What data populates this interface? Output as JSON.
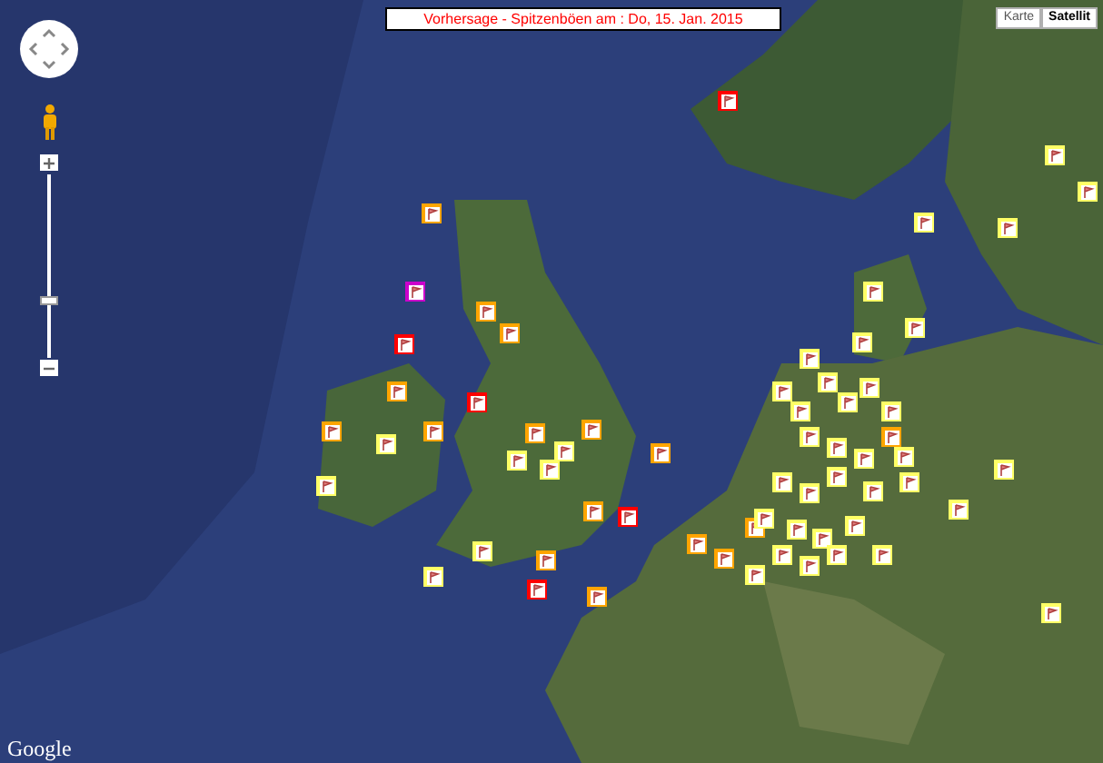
{
  "title_banner": "Vorhersage - Spitzenböen am : Do, 15. Jan. 2015",
  "map_type_buttons": [
    {
      "label": "Karte",
      "selected": false
    },
    {
      "label": "Satellit",
      "selected": true
    }
  ],
  "zoom_slider": {
    "level": 0.32
  },
  "logo": "Google",
  "markers": [
    {
      "color": "#ff0000"
    },
    {
      "color": "#cc00cc"
    },
    {
      "color": "#ffa500"
    },
    {
      "color": "#ffa500"
    },
    {
      "color": "#ffa500"
    },
    {
      "color": "#ff0000"
    },
    {
      "color": "#ffa500"
    },
    {
      "color": "#ffff66"
    },
    {
      "color": "#ffa500"
    },
    {
      "color": "#ff0000"
    },
    {
      "color": "#ffff66"
    },
    {
      "color": "#ffa500"
    },
    {
      "color": "#ffa500"
    },
    {
      "color": "#ffff66"
    },
    {
      "color": "#ffff66"
    },
    {
      "color": "#ff0000"
    },
    {
      "color": "#ffa500"
    },
    {
      "color": "#ffa500"
    },
    {
      "color": "#ffff66"
    },
    {
      "color": "#ffff66"
    },
    {
      "color": "#ff0000"
    },
    {
      "color": "#ffa500"
    },
    {
      "color": "#ffff66"
    },
    {
      "color": "#ffa500"
    },
    {
      "color": "#ffa500"
    },
    {
      "color": "#ffa500"
    },
    {
      "color": "#ffa500"
    },
    {
      "color": "#ffa500"
    },
    {
      "color": "#ffff66"
    },
    {
      "color": "#ffff66"
    },
    {
      "color": "#ffff66"
    },
    {
      "color": "#ffff66"
    },
    {
      "color": "#ffff66"
    },
    {
      "color": "#ffff66"
    },
    {
      "color": "#ffff66"
    },
    {
      "color": "#ffff66"
    },
    {
      "color": "#ffff66"
    },
    {
      "color": "#ffff66"
    },
    {
      "color": "#ffff66"
    },
    {
      "color": "#ffa500"
    },
    {
      "color": "#ffff66"
    },
    {
      "color": "#ffff66"
    },
    {
      "color": "#ffff66"
    },
    {
      "color": "#ffff66"
    },
    {
      "color": "#ffff66"
    },
    {
      "color": "#ffff66"
    },
    {
      "color": "#ffff66"
    },
    {
      "color": "#ffff66"
    },
    {
      "color": "#ffff66"
    },
    {
      "color": "#ffff66"
    },
    {
      "color": "#ffff66"
    },
    {
      "color": "#ffff66"
    },
    {
      "color": "#ffff66"
    },
    {
      "color": "#ffff66"
    },
    {
      "color": "#ffff66"
    },
    {
      "color": "#ffff66"
    },
    {
      "color": "#ffff66"
    },
    {
      "color": "#ffff66"
    },
    {
      "color": "#ffff66"
    },
    {
      "color": "#ffff66"
    },
    {
      "color": "#ffff66"
    },
    {
      "color": "#ffff66"
    },
    {
      "color": "#ffff66"
    },
    {
      "color": "#ffff66"
    }
  ]
}
